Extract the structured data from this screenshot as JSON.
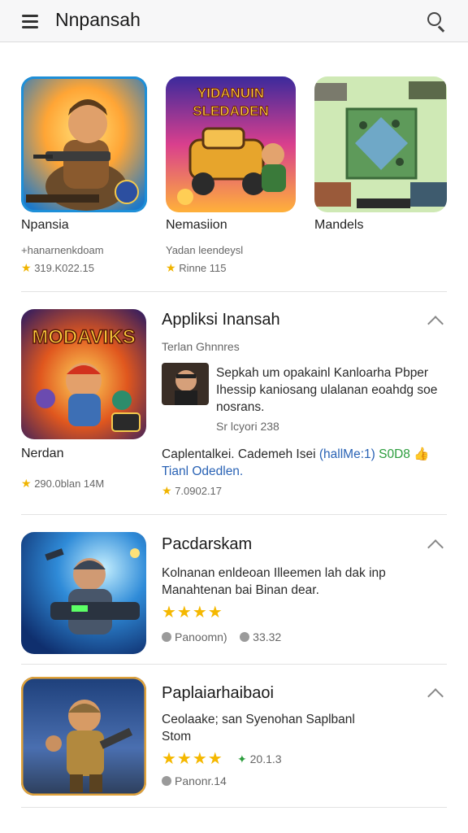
{
  "header": {
    "title": "Nnpansah"
  },
  "top_row": [
    {
      "title": "Npansia",
      "sub": "+hanarnenkdoam",
      "rating": "319.K022.15",
      "art_text": ""
    },
    {
      "title": "Nemasiion",
      "sub": "Yadan leendeysl",
      "rating": "Rinne 115",
      "art_text": "YIDANUIN SLEDADEN"
    },
    {
      "title": "Mandels",
      "sub": "",
      "rating": "",
      "art_text": ""
    }
  ],
  "section1": {
    "title": "Appliksi Inansah",
    "subtitle": "Terlan Ghnnres",
    "card_text": "Sepkah um opakainl Kanloarha Pbper Ihessip kaniosang ulalanan eoahdg soe nosrans.",
    "card_meta": "Sr lcyori 238",
    "detail_line_a": "Caplentalkei. Cademeh Isei",
    "detail_line_b": "(hallMe:1)",
    "detail_line_c": "S0D8",
    "detail_line_d": "Tianl Odedlen.",
    "rating": "7.0902.17",
    "game_title": "Nerdan",
    "game_rating": "290.0blan 14M",
    "art_text": "MODAVIKS"
  },
  "section2": {
    "title": "Pacdarskam",
    "desc": "Kolnanan enldeoan Illeemen lah dak inp Manahtenan bai Binan dear.",
    "stars": "★★★★",
    "meta_a": "Panoomn)",
    "meta_b": "33.32"
  },
  "section3": {
    "title": "Paplaiarhaibaoi",
    "desc": "Ceolaake; san Syenohan Saplbanl Stom",
    "stars": "★★★★",
    "score": "20.1.3",
    "meta": "Panonr.14"
  },
  "colors": {
    "accent_blue": "#2a63b5",
    "accent_green": "#2c9d3d",
    "star_gold": "#f5b800"
  }
}
